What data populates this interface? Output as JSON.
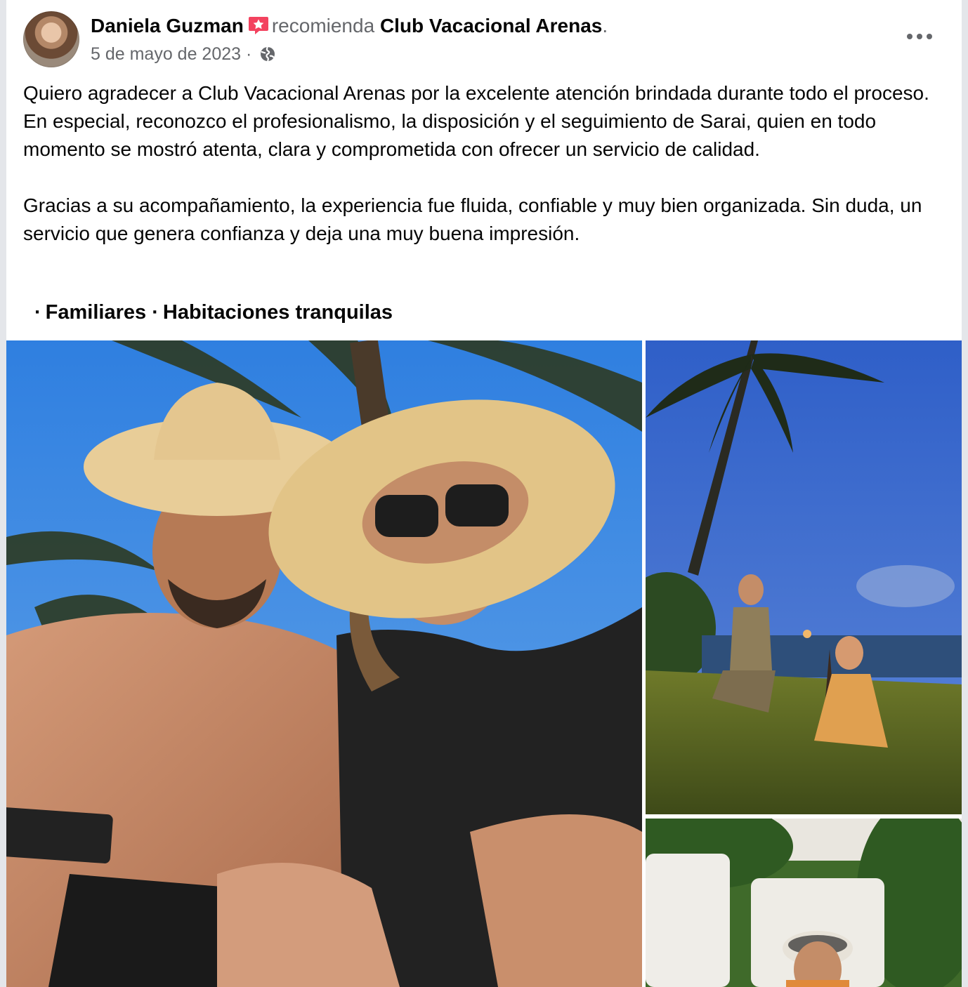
{
  "post": {
    "author": "Daniela Guzman",
    "recommend_verb": "recomienda",
    "page_name": "Club Vacacional Arenas",
    "page_name_suffix": ".",
    "date": "5 de mayo de 2023",
    "date_separator": "·",
    "privacy_icon": "globe-icon",
    "badge_icon": "recommend-badge-icon",
    "more_icon": "more-options-icon",
    "paragraphs": [
      "Quiero agradecer a Club Vacacional Arenas por la excelente atención brindada durante todo el proceso. En especial, reconozco el profesionalismo, la disposición y el seguimiento de Sarai, quien en todo momento se mostró atenta, clara y comprometida con ofrecer un servicio de calidad.",
      "Gracias a su acompañamiento, la experiencia fue fluida, confiable y muy bien organizada. Sin duda, un servicio que genera confianza y deja una muy buena impresión."
    ],
    "tags": [
      "Familiares",
      "Habitaciones tranquilas"
    ],
    "tag_separator": "·"
  },
  "colors": {
    "badge": "#f3425f",
    "muted_text": "#65676b",
    "sky": "#4a8fe0",
    "sunset_sky": "#3f66c8",
    "grass": "#7d8a2e"
  }
}
